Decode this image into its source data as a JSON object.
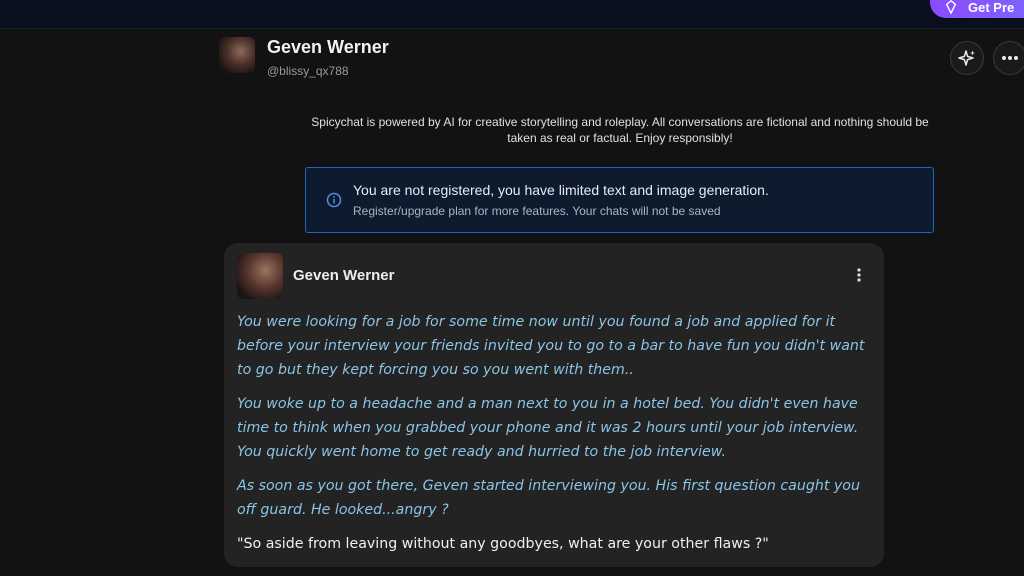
{
  "top": {
    "premium_label": "Get Pre"
  },
  "character": {
    "name": "Geven Werner",
    "handle": "@blissy_qx788"
  },
  "disclaimer": {
    "text": "Spicychat is powered by AI for creative storytelling and roleplay. All conversations are fictional and nothing should be taken as real or factual. Enjoy responsibly!"
  },
  "notice": {
    "title": "You are not registered, you have limited text and image generation.",
    "subtitle": "Register/upgrade plan for more features. Your chats will not be saved",
    "icon": "info-icon",
    "border_color": "#1e63c5"
  },
  "message": {
    "author": "Geven Werner",
    "paragraphs": [
      "You were looking for a job for some time now until you found a job and applied for it before your interview your friends invited you to go to a bar to have fun you didn't want to go but they kept forcing you so you went with them..",
      "You woke up to a headache and a man next to you in a hotel bed. You didn't even have time to think when you grabbed your phone and it was 2 hours until your job interview. You quickly went home to get ready and hurried to the job interview.",
      "As soon as you got there, Geven started interviewing you. His first question caught you off guard. He looked...angry ?"
    ],
    "quote": "\"So aside from leaving without any goodbyes, what are your other flaws ?\"",
    "narration_color": "#8ac4e6"
  },
  "icons": [
    "gem-icon",
    "sparkle-icon",
    "more-horizontal-icon",
    "info-icon",
    "more-vertical-icon"
  ]
}
